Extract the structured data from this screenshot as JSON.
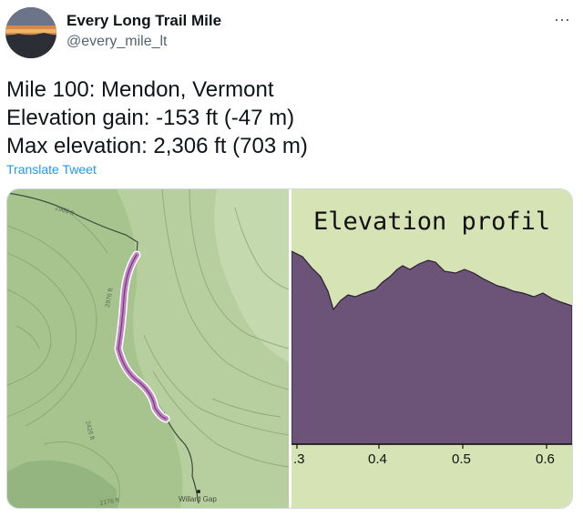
{
  "tweet": {
    "author_name": "Every Long Trail Mile",
    "author_handle": "@every_mile_lt",
    "more_icon": "⋯",
    "lines": [
      "Mile 100: Mendon, Vermont",
      "Elevation gain: -153 ft (-47 m)",
      "Max elevation: 2,306 ft (703 m)"
    ],
    "translate_label": "Translate Tweet"
  },
  "map": {
    "labels": [
      "2968 ft",
      "2976 ft",
      "2426 ft",
      "2176 ft",
      "Willard Gap"
    ],
    "route_color": "#c27fc6",
    "terrain_color": "#9fbf8c"
  },
  "chart_data": {
    "type": "area",
    "title": "Elevation profil",
    "x_ticks": [
      ".3",
      "0.4",
      "0.5",
      "0.6"
    ],
    "fill_color": "#6c5479",
    "background_color": "#d5e3b5"
  }
}
